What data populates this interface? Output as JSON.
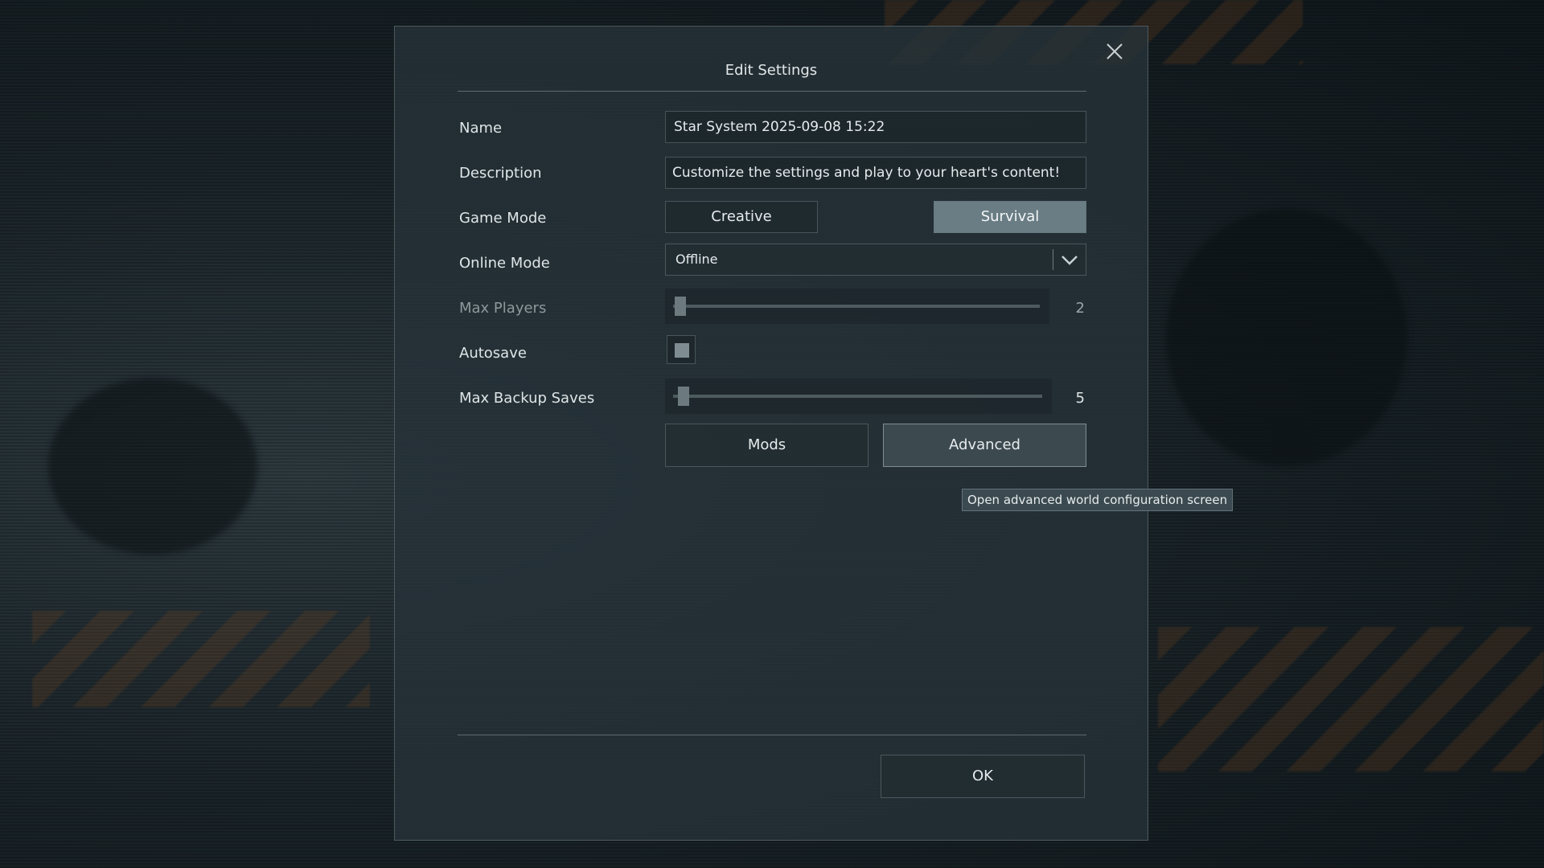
{
  "dialog": {
    "title": "Edit Settings",
    "close_icon": "close-icon"
  },
  "fields": {
    "name": {
      "label": "Name",
      "value": "Star System 2025-09-08 15:22"
    },
    "description": {
      "label": "Description",
      "value": "Customize the settings and play to your heart's content!"
    },
    "game_mode": {
      "label": "Game Mode",
      "options": [
        "Creative",
        "Survival"
      ],
      "selected": "Survival"
    },
    "online_mode": {
      "label": "Online Mode",
      "value": "Offline",
      "icon": "chevron-down-icon"
    },
    "max_players": {
      "label": "Max Players",
      "value": "2",
      "fraction": 0.02
    },
    "autosave": {
      "label": "Autosave",
      "checked": true
    },
    "max_backup_saves": {
      "label": "Max Backup Saves",
      "value": "5",
      "fraction": 0.02
    }
  },
  "buttons": {
    "mods": "Mods",
    "advanced": "Advanced",
    "ok": "OK"
  },
  "tooltip": {
    "text": "Open advanced world configuration screen"
  },
  "colors": {
    "active_button": "#6a7d84",
    "panel": "#263238"
  }
}
